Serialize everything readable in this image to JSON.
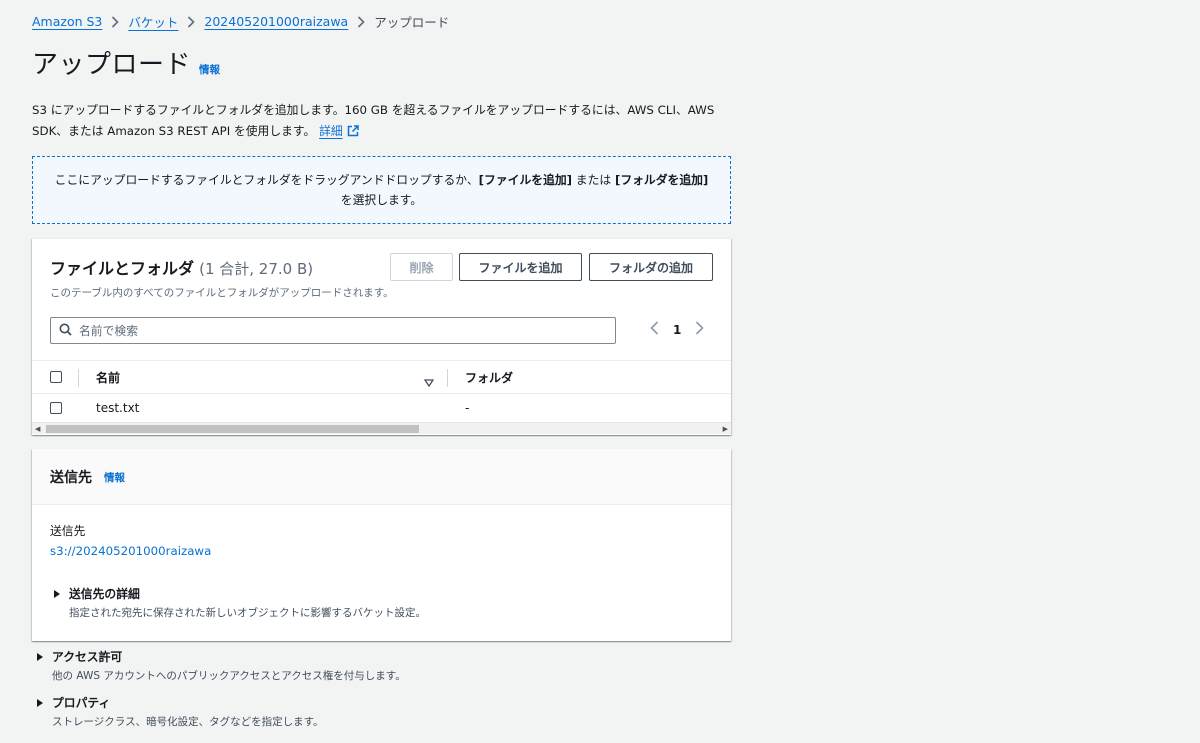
{
  "breadcrumb": {
    "items": [
      "Amazon S3",
      "バケット",
      "202405201000raizawa"
    ],
    "current": "アップロード"
  },
  "header": {
    "title": "アップロード",
    "info": "情報"
  },
  "description": {
    "text": "S3 にアップロードするファイルとフォルダを追加します。160 GB を超えるファイルをアップロードするには、AWS CLI、AWS SDK、または Amazon S3 REST API を使用します。",
    "more": "詳細"
  },
  "dropzone": {
    "pre": "ここにアップロードするファイルとフォルダをドラッグアンドドロップするか、",
    "add_file": "[ファイルを追加]",
    "or": " または ",
    "add_folder": "[フォルダを追加]",
    "post": " を選択します。"
  },
  "files": {
    "title": "ファイルとフォルダ",
    "count": "(1 合計, 27.0 B)",
    "subtitle": "このテーブル内のすべてのファイルとフォルダがアップロードされます。",
    "delete_label": "削除",
    "add_file_label": "ファイルを追加",
    "add_folder_label": "フォルダの追加",
    "search_placeholder": "名前で検索",
    "page": "1",
    "columns": [
      "名前",
      "フォルダ"
    ],
    "rows": [
      {
        "name": "test.txt",
        "folder": "-"
      }
    ]
  },
  "destination": {
    "title": "送信先",
    "info": "情報",
    "label": "送信先",
    "value": "s3://202405201000raizawa",
    "details_title": "送信先の詳細",
    "details_desc": "指定された宛先に保存された新しいオブジェクトに影響するバケット設定。"
  },
  "access": {
    "title": "アクセス許可",
    "desc": "他の AWS アカウントへのパブリックアクセスとアクセス権を付与します。"
  },
  "properties": {
    "title": "プロパティ",
    "desc": "ストレージクラス、暗号化設定、タグなどを指定します。"
  },
  "colors": {
    "link": "#0972d3",
    "background": "#f2f3f3",
    "dropzone_bg": "#f2f8fd"
  }
}
